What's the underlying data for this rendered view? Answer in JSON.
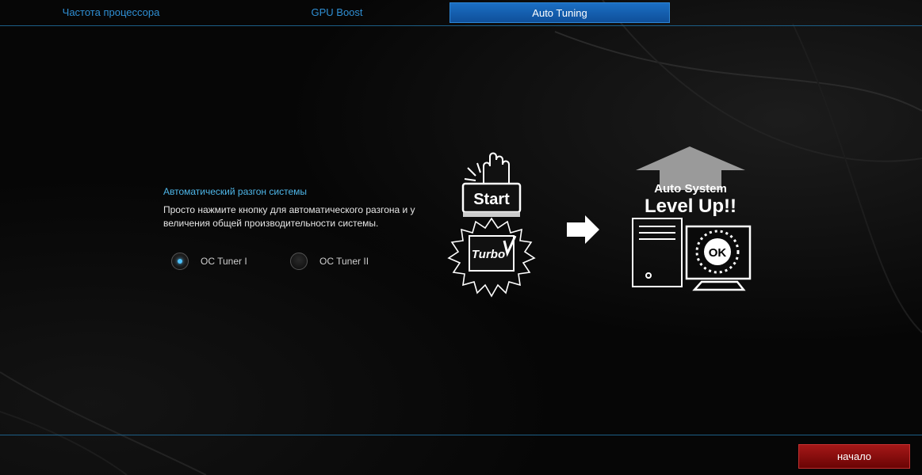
{
  "tabs": [
    {
      "label": "Частота процессора",
      "active": false
    },
    {
      "label": "GPU Boost",
      "active": false
    },
    {
      "label": "Auto Tuning",
      "active": true
    }
  ],
  "panel": {
    "title": "Автоматический разгон системы",
    "description": "Просто нажмите кнопку для автоматического разгона и у величения общей производительности системы.",
    "options": [
      {
        "label": "OC Tuner I",
        "selected": true
      },
      {
        "label": "OC Tuner II",
        "selected": false
      }
    ]
  },
  "illustration": {
    "start_label": "Start",
    "chip_label": "Turbo",
    "headline_line1": "Auto System",
    "headline_line2": "Level Up!!",
    "ok_label": "OK"
  },
  "footer": {
    "start_button_label": "начало"
  },
  "colors": {
    "accent_blue": "#2f8fd4",
    "active_tab": "#1b6fc4",
    "title_blue": "#4eb6e8",
    "start_red": "#a51818",
    "divider": "#1c5e86"
  }
}
